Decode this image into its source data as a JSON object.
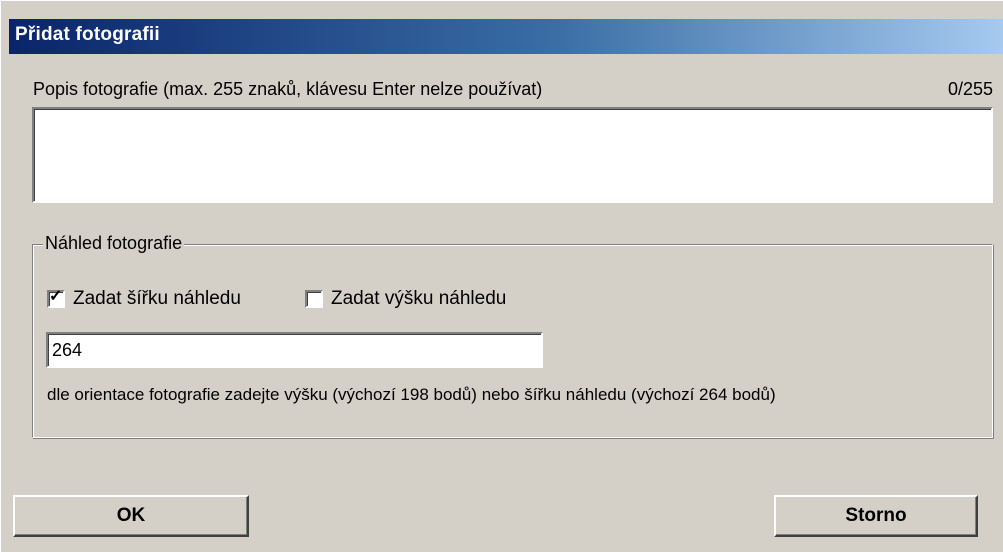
{
  "window": {
    "title": "Přidat fotografii"
  },
  "description": {
    "label": "Popis fotografie (max. 255 znaků, klávesu Enter nelze používat)",
    "counter": "0/255",
    "value": ""
  },
  "preview": {
    "legend": "Náhled fotografie",
    "width_checkbox": {
      "label": "Zadat šířku náhledu",
      "checked": true
    },
    "height_checkbox": {
      "label": "Zadat výšku náhledu",
      "checked": false
    },
    "size_value": "264",
    "hint": "dle orientace fotografie zadejte výšku (výchozí 198 bodů) nebo šířku náhledu (výchozí 264 bodů)"
  },
  "buttons": {
    "ok_label": "OK",
    "cancel_label": "Storno"
  },
  "colors": {
    "titlebar_start": "#0a246a",
    "titlebar_end": "#a6caf0",
    "dialog_bg": "#d4d0c8"
  },
  "icons": {
    "checkmark": "checkmark-icon"
  }
}
